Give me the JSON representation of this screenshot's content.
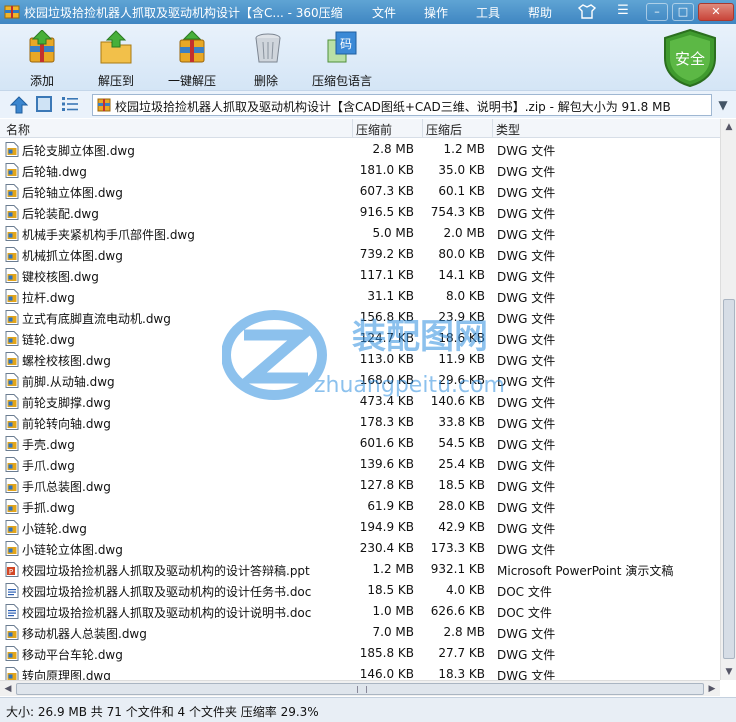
{
  "window": {
    "title": "校园垃圾拾捡机器人抓取及驱动机构设计【含C... - 360压缩",
    "menu": [
      "文件",
      "操作",
      "工具",
      "帮助"
    ]
  },
  "toolbar": {
    "add_label": "添加",
    "extract_label": "解压到",
    "onekey_label": "一键解压",
    "delete_label": "删除",
    "lang_label": "压缩包语言",
    "lang_icon_text": "码",
    "security_label": "安全"
  },
  "address": {
    "path": "校园垃圾拾捡机器人抓取及驱动机构设计【含CAD图纸+CAD三维、说明书】.zip - 解包大小为 91.8 MB"
  },
  "columns": {
    "name": "名称",
    "compressed": "压缩前",
    "uncompressed": "压缩后",
    "type": "类型"
  },
  "files": [
    {
      "name": "后轮支脚立体图.dwg",
      "before": "2.8 MB",
      "after": "1.2 MB",
      "type": "DWG 文件",
      "kind": "dwg"
    },
    {
      "name": "后轮轴.dwg",
      "before": "181.0 KB",
      "after": "35.0 KB",
      "type": "DWG 文件",
      "kind": "dwg"
    },
    {
      "name": "后轮轴立体图.dwg",
      "before": "607.3 KB",
      "after": "60.1 KB",
      "type": "DWG 文件",
      "kind": "dwg"
    },
    {
      "name": "后轮装配.dwg",
      "before": "916.5 KB",
      "after": "754.3 KB",
      "type": "DWG 文件",
      "kind": "dwg"
    },
    {
      "name": "机械手夹紧机构手爪部件图.dwg",
      "before": "5.0 MB",
      "after": "2.0 MB",
      "type": "DWG 文件",
      "kind": "dwg"
    },
    {
      "name": "机械抓立体图.dwg",
      "before": "739.2 KB",
      "after": "80.0 KB",
      "type": "DWG 文件",
      "kind": "dwg"
    },
    {
      "name": "键校核图.dwg",
      "before": "117.1 KB",
      "after": "14.1 KB",
      "type": "DWG 文件",
      "kind": "dwg"
    },
    {
      "name": "拉杆.dwg",
      "before": "31.1 KB",
      "after": "8.0 KB",
      "type": "DWG 文件",
      "kind": "dwg"
    },
    {
      "name": "立式有底脚直流电动机.dwg",
      "before": "156.8 KB",
      "after": "23.9 KB",
      "type": "DWG 文件",
      "kind": "dwg"
    },
    {
      "name": "链轮.dwg",
      "before": "124.7 KB",
      "after": "18.6 KB",
      "type": "DWG 文件",
      "kind": "dwg"
    },
    {
      "name": "螺栓校核图.dwg",
      "before": "113.0 KB",
      "after": "11.9 KB",
      "type": "DWG 文件",
      "kind": "dwg"
    },
    {
      "name": "前脚.从动轴.dwg",
      "before": "168.0 KB",
      "after": "29.6 KB",
      "type": "DWG 文件",
      "kind": "dwg"
    },
    {
      "name": "前轮支脚撑.dwg",
      "before": "473.4 KB",
      "after": "140.6 KB",
      "type": "DWG 文件",
      "kind": "dwg"
    },
    {
      "name": "前轮转向轴.dwg",
      "before": "178.3 KB",
      "after": "33.8 KB",
      "type": "DWG 文件",
      "kind": "dwg"
    },
    {
      "name": "手壳.dwg",
      "before": "601.6 KB",
      "after": "54.5 KB",
      "type": "DWG 文件",
      "kind": "dwg"
    },
    {
      "name": "手爪.dwg",
      "before": "139.6 KB",
      "after": "25.4 KB",
      "type": "DWG 文件",
      "kind": "dwg"
    },
    {
      "name": "手爪总装图.dwg",
      "before": "127.8 KB",
      "after": "18.5 KB",
      "type": "DWG 文件",
      "kind": "dwg"
    },
    {
      "name": "手抓.dwg",
      "before": "61.9 KB",
      "after": "28.0 KB",
      "type": "DWG 文件",
      "kind": "dwg"
    },
    {
      "name": "小链轮.dwg",
      "before": "194.9 KB",
      "after": "42.9 KB",
      "type": "DWG 文件",
      "kind": "dwg"
    },
    {
      "name": "小链轮立体图.dwg",
      "before": "230.4 KB",
      "after": "173.3 KB",
      "type": "DWG 文件",
      "kind": "dwg"
    },
    {
      "name": "校园垃圾拾捡机器人抓取及驱动机构的设计答辩稿.ppt",
      "before": "1.2 MB",
      "after": "932.1 KB",
      "type": "Microsoft PowerPoint 演示文稿",
      "kind": "ppt"
    },
    {
      "name": "校园垃圾拾捡机器人抓取及驱动机构的设计任务书.doc",
      "before": "18.5 KB",
      "after": "4.0 KB",
      "type": "DOC 文件",
      "kind": "doc"
    },
    {
      "name": "校园垃圾拾捡机器人抓取及驱动机构的设计说明书.doc",
      "before": "1.0 MB",
      "after": "626.6 KB",
      "type": "DOC 文件",
      "kind": "doc"
    },
    {
      "name": "移动机器人总装图.dwg",
      "before": "7.0 MB",
      "after": "2.8 MB",
      "type": "DWG 文件",
      "kind": "dwg"
    },
    {
      "name": "移动平台车轮.dwg",
      "before": "185.8 KB",
      "after": "27.7 KB",
      "type": "DWG 文件",
      "kind": "dwg"
    },
    {
      "name": "转向原理图.dwg",
      "before": "146.0 KB",
      "after": "18.3 KB",
      "type": "DWG 文件",
      "kind": "dwg"
    }
  ],
  "watermark": {
    "cn": "装配图网",
    "en": "zhuangpeitu.com"
  },
  "status": {
    "text": "大小: 26.9 MB 共 71 个文件和 4 个文件夹 压缩率 29.3%"
  },
  "colors": {
    "titlebar": "#3f86c2",
    "toolbar": "#dbe9f7",
    "security_green": "#3f9a2e",
    "watermark_blue": "#2f8fe0"
  }
}
